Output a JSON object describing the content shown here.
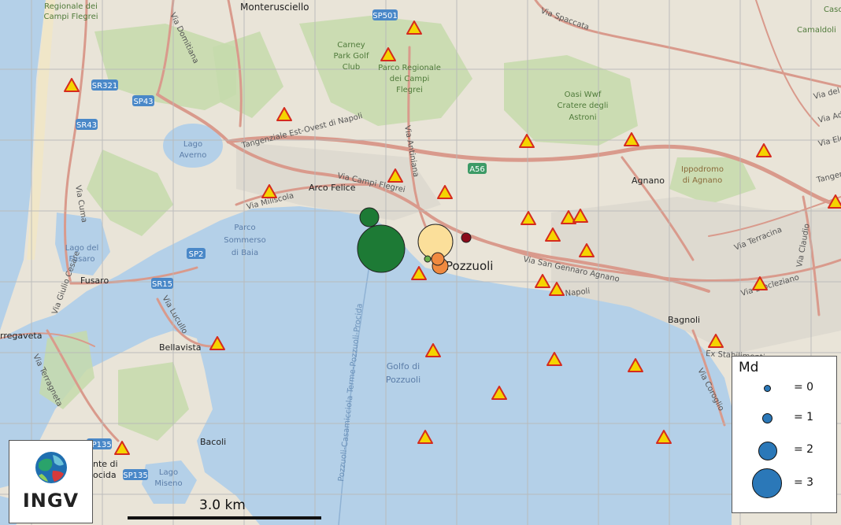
{
  "map": {
    "places": {
      "monterusciello": "Monterusciello",
      "regionale_campi_flegrei_1": "Regionale dei",
      "regionale_campi_flegrei_2": "Campi Flegrei",
      "carney_1": "Carney",
      "carney_2": "Park Golf",
      "carney_3": "Club",
      "parco_reg_1": "Parco Regionale",
      "parco_reg_2": "dei Campi",
      "parco_reg_3": "Flegrei",
      "oasi_1": "Oasi Wwf",
      "oasi_2": "Cratere degli",
      "oasi_3": "Astroni",
      "lago_averno_1": "Lago",
      "lago_averno_2": "Averno",
      "arco_felice": "Arco Felice",
      "agnano": "Agnano",
      "ippodromo_1": "Ippodromo",
      "ippodromo_2": "di Agnano",
      "camaldoli": "Camaldoli",
      "parco_sommerso_1": "Parco",
      "parco_sommerso_2": "Sommerso",
      "parco_sommerso_3": "di Baia",
      "lago_fusaro_1": "Lago del",
      "lago_fusaro_2": "Fusaro",
      "fusaro": "Fusaro",
      "pozzuoli": "Pozzuoli",
      "torregaveta": "rregaveta",
      "bellavista": "Bellavista",
      "golfo_1": "Golfo di",
      "golfo_2": "Pozzuoli",
      "bagnoli": "Bagnoli",
      "bacoli": "Bacoli",
      "lago_miseno_1": "Lago",
      "lago_miseno_2": "Miseno",
      "monte_procida_1": "nte di",
      "monte_procida_2": "ocida",
      "caso": "Caso"
    },
    "roads": {
      "sp501": "SP501",
      "sr321": "SR321",
      "sp43": "SP43",
      "sr43": "SR43",
      "a56": "A56",
      "sp2": "SP2",
      "sr15": "SR15",
      "sp135a": "SP135",
      "sp135b": "SP135",
      "via_spaccata": "Via Spaccata",
      "via_campi_flegrei": "Via Campi Flegrei",
      "via_miliscola": "Via Miliscola",
      "via_san_gennaro": "Via San Gennaro Agnano",
      "via_napoli": "Napoli",
      "via_terracina": "Via Terracina",
      "via_claudio": "Via Claudio",
      "via_diocleziano": "Via Diocleziano",
      "via_coroglio": "Via Coroglio",
      "ex_stabilimenti": "Ex Stabilimenti",
      "via_cuma": "Via Cuma",
      "via_giulio_cesare": "Via Giulio Cesare",
      "via_lucullo": "Via Lucullo",
      "via_terragneta": "Via Terragneta",
      "tangenziale": "Tangenziale Est-Ovest di Napoli",
      "via_domitiana": "Via Domitiana",
      "ferry": "Pozzuoli-Casamicciola Terme-Pozzuoli-Procida",
      "via_antiniana": "Via Antiniana",
      "via_tangenziale_e": "Tangenzi",
      "via_della": "Via del",
      "via_adr": "Via Adri",
      "via_eleve": "Via Ele"
    },
    "colors": {
      "sea": "#b4d0e8",
      "land": "#e9e4d8",
      "green": "#c6dbab",
      "road": "#d99a8c",
      "station_fill": "#f5d400",
      "station_stroke": "#d52b1e",
      "grid": "#b9b9b9"
    }
  },
  "earthquakes": [
    {
      "magnitude": 3.0,
      "color": "#1d7a35",
      "label": "large green event"
    },
    {
      "magnitude": 1.2,
      "color": "#1d7a35",
      "label": "small green event"
    },
    {
      "magnitude": 2.2,
      "color": "#fbdf9a",
      "label": "yellow event"
    },
    {
      "magnitude": 0.8,
      "color": "#f08a40",
      "label": "orange event"
    },
    {
      "magnitude": 1.0,
      "color": "#f08a40",
      "label": "orange event 2"
    },
    {
      "magnitude": 0.4,
      "color": "#8b0a1a",
      "label": "dark red event"
    },
    {
      "magnitude": 0.2,
      "color": "#6ab04c",
      "label": "light green event"
    }
  ],
  "legend": {
    "title": "Md",
    "items": [
      {
        "label": "= 0",
        "md": 0
      },
      {
        "label": "= 1",
        "md": 1
      },
      {
        "label": "= 2",
        "md": 2
      },
      {
        "label": "= 3",
        "md": 3
      }
    ]
  },
  "scale": {
    "label": "3.0 km"
  },
  "logo": {
    "name": "INGV"
  }
}
